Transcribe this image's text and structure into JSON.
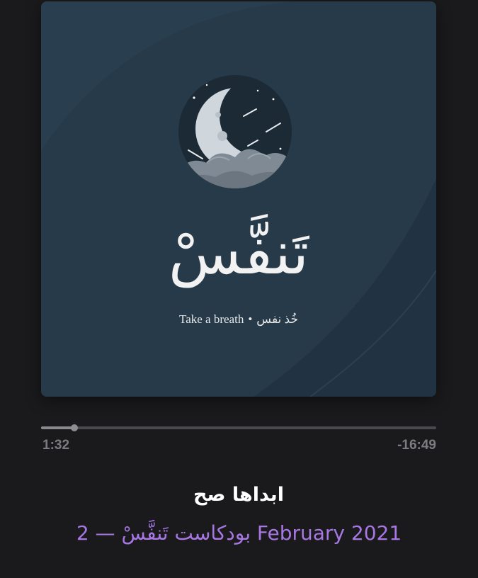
{
  "artwork": {
    "title_ar": "تَنفَّسْ",
    "tagline_en": "Take a breath",
    "tagline_separator": "•",
    "tagline_ar": "خُذ نفس",
    "icon": "crescent-moon-icon",
    "colors": {
      "background": "#263a4a",
      "moon_badge": "#1c2a35",
      "text": "#f2f2f2"
    }
  },
  "playback": {
    "progress_fraction": 0.085,
    "elapsed": "1:32",
    "remaining": "-16:49"
  },
  "episode": {
    "title": "ابداها صح",
    "meta": "بودكاست تَنفَّسْ — 2 February 2021"
  },
  "colors": {
    "page_background": "#1a1a1c",
    "accent": "#a777e3",
    "muted_text": "#7c7c80"
  }
}
